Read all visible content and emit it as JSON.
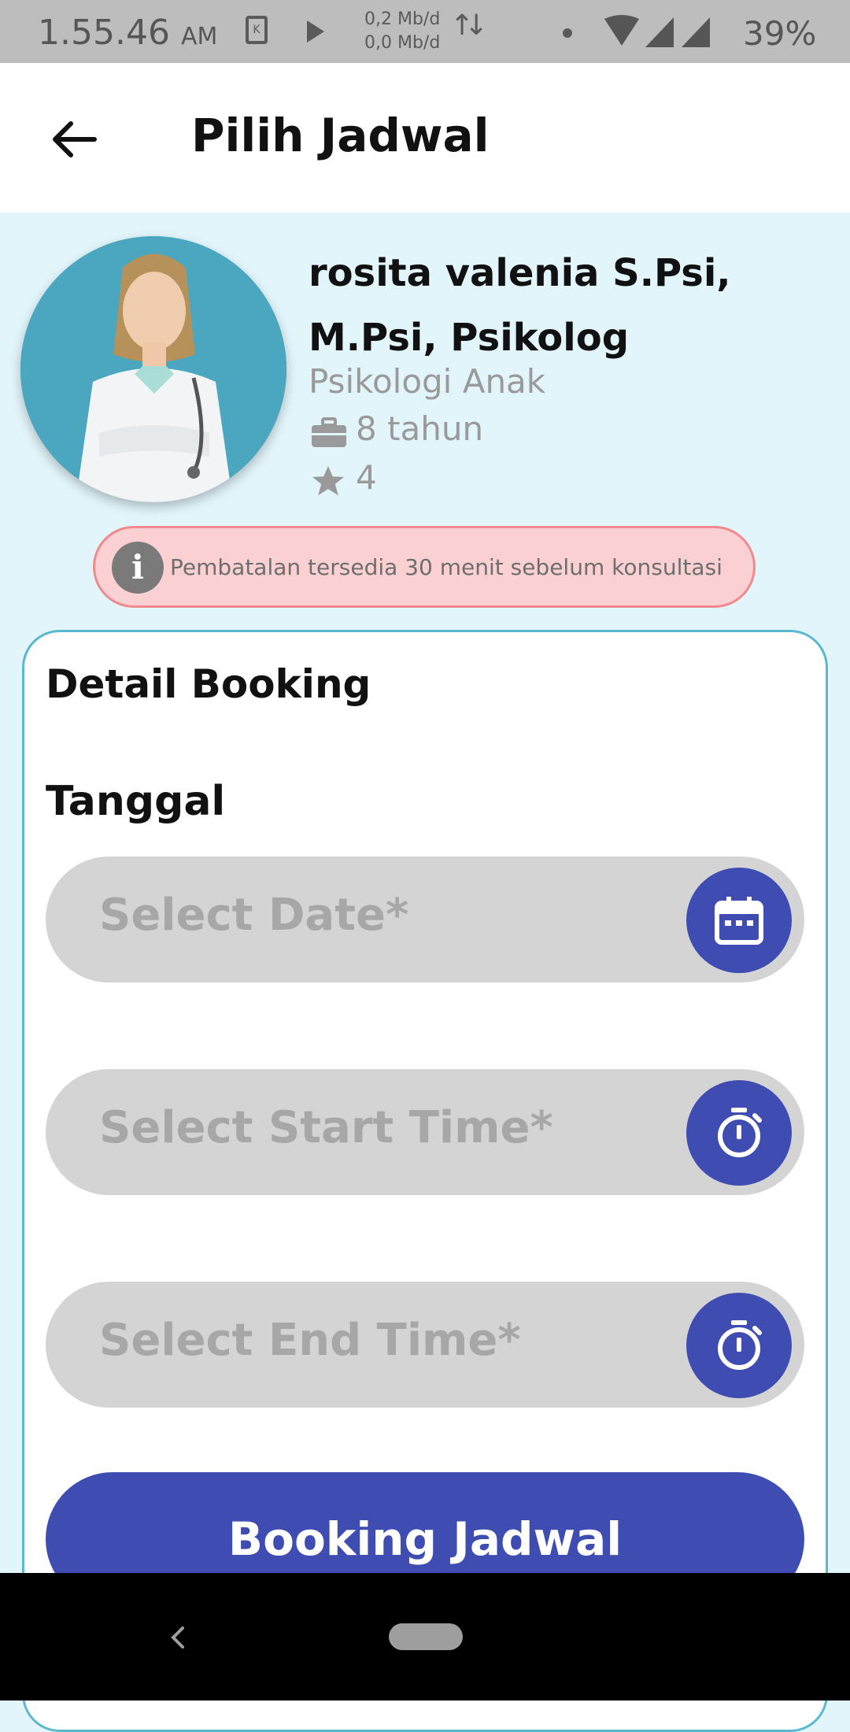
{
  "status_bar": {
    "time": "1.55.46",
    "ampm": "AM",
    "speed_up": "0,2 Mb/d",
    "speed_down": "0,0 Mb/d",
    "battery": "39%"
  },
  "app_bar": {
    "title": "Pilih Jadwal"
  },
  "doctor": {
    "name": "rosita valenia S.Psi, M.Psi, Psikolog",
    "specialty": "Psikologi Anak",
    "experience": "8 tahun",
    "rating": "4"
  },
  "notice": {
    "text": "Pembatalan tersedia 30 menit sebelum konsultasi"
  },
  "booking": {
    "title": "Detail Booking",
    "date_label": "Tanggal",
    "date_placeholder": "Select Date*",
    "start_placeholder": "Select Start Time*",
    "end_placeholder": "Select End Time*",
    "submit_label": "Booking Jadwal"
  },
  "colors": {
    "primary": "#3f4db2",
    "background": "#e2f5fb",
    "notice_bg": "#fbd0d2",
    "notice_border": "#f08a8e",
    "field_bg": "#d4d4d4"
  }
}
